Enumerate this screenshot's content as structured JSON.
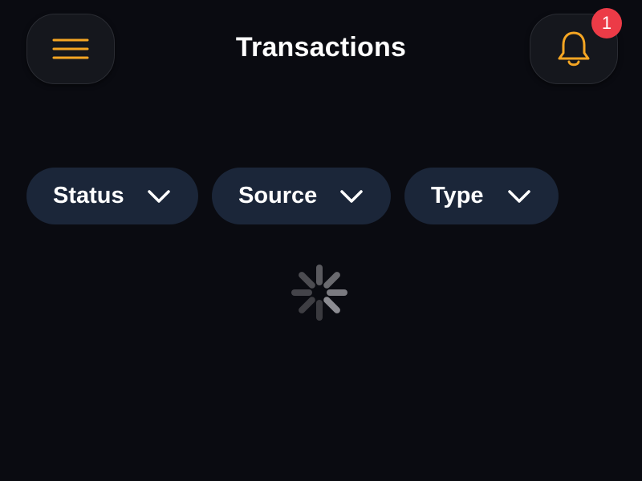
{
  "header": {
    "title": "Transactions",
    "menu_icon": "hamburger-menu-icon",
    "notification_icon": "bell-icon",
    "notification_count": "1",
    "accent_color": "#f5a623",
    "badge_color": "#ec3b47"
  },
  "filters": [
    {
      "label": "Status",
      "icon": "chevron-down-icon"
    },
    {
      "label": "Source",
      "icon": "chevron-down-icon"
    },
    {
      "label": "Type",
      "icon": "chevron-down-icon"
    }
  ],
  "loading": {
    "icon": "loading-spinner-icon"
  }
}
